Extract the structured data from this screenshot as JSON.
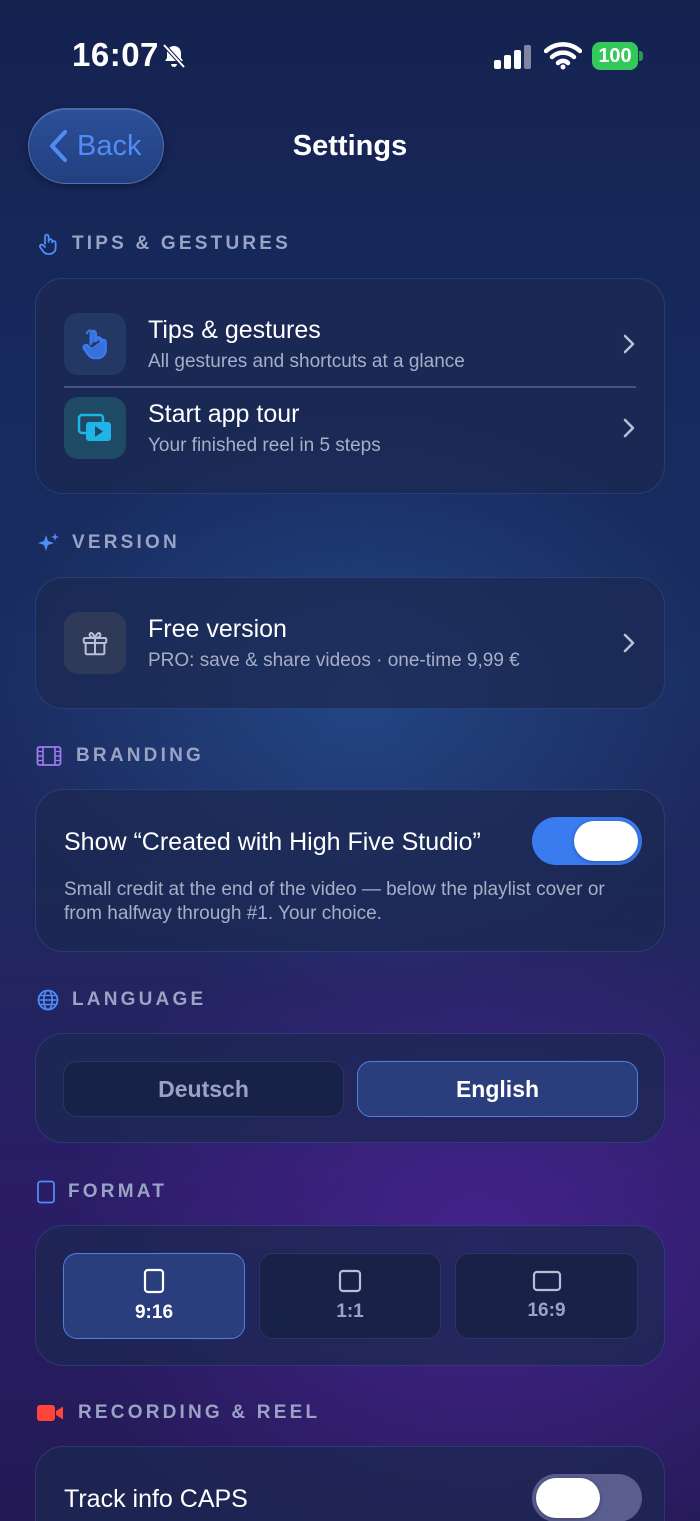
{
  "status_bar": {
    "time": "16:07",
    "battery": "100"
  },
  "nav": {
    "back_label": "Back",
    "title": "Settings"
  },
  "sections": {
    "tips": {
      "header": "TIPS & GESTURES",
      "items": [
        {
          "title": "Tips & gestures",
          "subtitle": "All gestures and shortcuts at a glance",
          "icon": "hand-pointer-icon"
        },
        {
          "title": "Start app tour",
          "subtitle": "Your finished reel in 5 steps",
          "icon": "play-stack-icon"
        }
      ]
    },
    "version": {
      "header": "VERSION",
      "item": {
        "title": "Free version",
        "subtitle": "PRO: save & share videos · one-time 9,99 €",
        "icon": "gift-icon"
      }
    },
    "branding": {
      "header": "BRANDING",
      "toggle_label": "Show “Created with High Five Studio”",
      "toggle_on": true,
      "description": "Small credit at the end of the video — below the playlist cover or from halfway through #1. Your choice."
    },
    "language": {
      "header": "LANGUAGE",
      "options": [
        "Deutsch",
        "English"
      ],
      "selected": "English"
    },
    "format": {
      "header": "FORMAT",
      "options": [
        "9:16",
        "1:1",
        "16:9"
      ],
      "selected": "9:16"
    },
    "recording": {
      "header": "RECORDING & REEL",
      "toggle_label": "Track info CAPS",
      "toggle_on": false
    }
  },
  "colors": {
    "accent": "#3a7bf0",
    "section_header": "#9aa3c4",
    "battery_green": "#34c759",
    "recording_red": "#ff453a",
    "branding_purple": "#a27bf0"
  }
}
